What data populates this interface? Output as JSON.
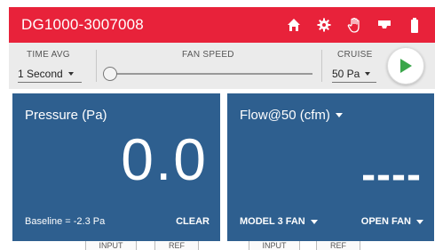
{
  "header": {
    "title": "DG1000-3007008",
    "background": "#e8223a",
    "icons": [
      "home-icon",
      "gear-icon",
      "hand-icon",
      "wifi-router-icon",
      "battery-icon"
    ]
  },
  "controls": {
    "time_avg": {
      "label": "TIME AVG",
      "value": "1 Second"
    },
    "fan_speed": {
      "label": "FAN SPEED",
      "level": 0
    },
    "cruise": {
      "label": "CRUISE",
      "value": "50 Pa"
    },
    "play_icon": "play-icon",
    "play_color": "#3aa64a"
  },
  "pressure_panel": {
    "title": "Pressure (Pa)",
    "value": "0.0",
    "baseline": "Baseline = -2.3 Pa",
    "clear_label": "CLEAR"
  },
  "flow_panel": {
    "title": "Flow@50 (cfm)",
    "value": "----",
    "model_label": "MODEL 3 FAN",
    "config_label": "OPEN FAN"
  },
  "bottom_tabs": [
    "INPUT",
    "REF",
    "INPUT",
    "REF"
  ],
  "colors": {
    "panel": "#2e5f8f",
    "control_bar": "#ebebeb"
  }
}
